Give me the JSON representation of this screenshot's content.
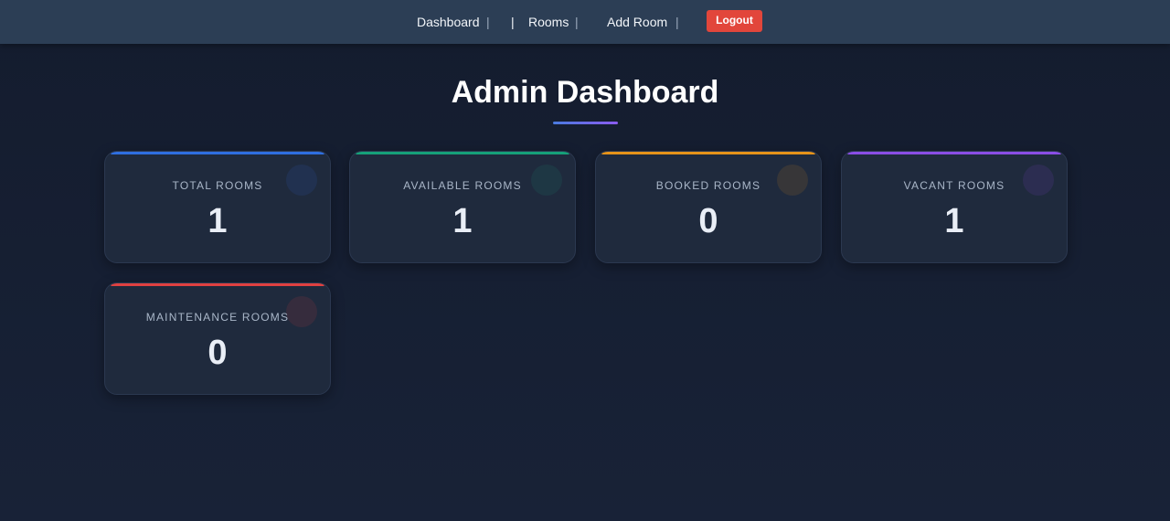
{
  "nav": {
    "items": [
      {
        "label": "Dashboard"
      },
      {
        "label": "Rooms"
      },
      {
        "label": "Add Room"
      }
    ],
    "separator": "|",
    "logout_label": "Logout",
    "logout_color": "#e2463b"
  },
  "page": {
    "title": "Admin Dashboard"
  },
  "stats": [
    {
      "label": "TOTAL ROOMS",
      "value": "1",
      "accent": "#2f6fe0"
    },
    {
      "label": "AVAILABLE ROOMS",
      "value": "1",
      "accent": "#16a079"
    },
    {
      "label": "BOOKED ROOMS",
      "value": "0",
      "accent": "#e5931a"
    },
    {
      "label": "VACANT ROOMS",
      "value": "1",
      "accent": "#8a4ee6"
    },
    {
      "label": "MAINTENANCE ROOMS",
      "value": "0",
      "accent": "#e04141"
    }
  ]
}
